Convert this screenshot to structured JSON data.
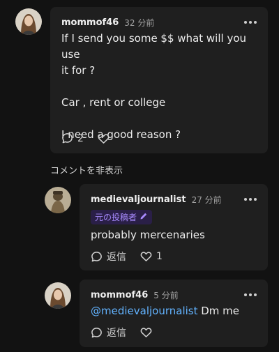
{
  "comments": [
    {
      "username": "mommof46",
      "time": "32 分前",
      "body": [
        "If I send you some $$ what will you use",
        "it for ?",
        "",
        "Car , rent or college",
        "",
        "I need a good reason ?"
      ],
      "reply_count": "2"
    }
  ],
  "hide_replies_label": "コメントを非表示",
  "replies": [
    {
      "username": "medievaljournalist",
      "time": "27 分前",
      "op_badge": "元の投稿者",
      "body": "probably mercenaries",
      "reply_label": "返信",
      "like_count": "1"
    },
    {
      "username": "mommof46",
      "time": "5 分前",
      "mention": "@medievaljournalist",
      "body": " Dm me",
      "reply_label": "返信"
    }
  ],
  "colors": {
    "background": "#121212",
    "card": "#1f1f1f",
    "mention": "#62b3ff",
    "badge_text": "#a98bff",
    "badge_bg": "#2a1f47"
  },
  "icons": [
    "comment-bubble-icon",
    "heart-icon",
    "pencil-icon",
    "more-dots-icon"
  ]
}
